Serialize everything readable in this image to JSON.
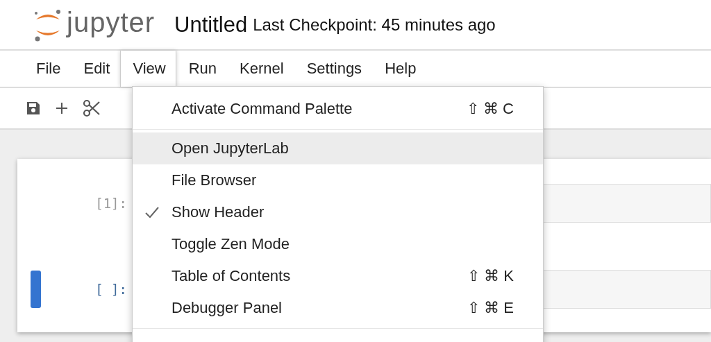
{
  "header": {
    "logo_text": "jupyter",
    "title": "Untitled",
    "checkpoint": "Last Checkpoint: 45 minutes ago"
  },
  "menubar": [
    {
      "label": "File",
      "selected": false
    },
    {
      "label": "Edit",
      "selected": false
    },
    {
      "label": "View",
      "selected": true
    },
    {
      "label": "Run",
      "selected": false
    },
    {
      "label": "Kernel",
      "selected": false
    },
    {
      "label": "Settings",
      "selected": false
    },
    {
      "label": "Help",
      "selected": false
    }
  ],
  "toolbar": [
    {
      "kind": "save"
    },
    {
      "kind": "add"
    },
    {
      "kind": "cut"
    }
  ],
  "cells": [
    {
      "prompt": "[1]:",
      "active": false
    },
    {
      "prompt": "[ ]:",
      "active": true
    }
  ],
  "view_menu": {
    "groups": [
      {
        "items": [
          {
            "label": "Activate Command Palette",
            "shortcut": "⇧ ⌘ C",
            "checked": false,
            "selected": false
          }
        ]
      },
      {
        "items": [
          {
            "label": "Open JupyterLab",
            "checked": false,
            "selected": true
          },
          {
            "label": "File Browser",
            "checked": false,
            "selected": false
          },
          {
            "label": "Show Header",
            "checked": true,
            "selected": false
          },
          {
            "label": "Toggle Zen Mode",
            "checked": false,
            "selected": false
          },
          {
            "label": "Table of Contents",
            "shortcut": "⇧ ⌘ K",
            "checked": false,
            "selected": false
          },
          {
            "label": "Debugger Panel",
            "shortcut": "⇧ ⌘ E",
            "checked": false,
            "selected": false
          }
        ]
      }
    ]
  }
}
